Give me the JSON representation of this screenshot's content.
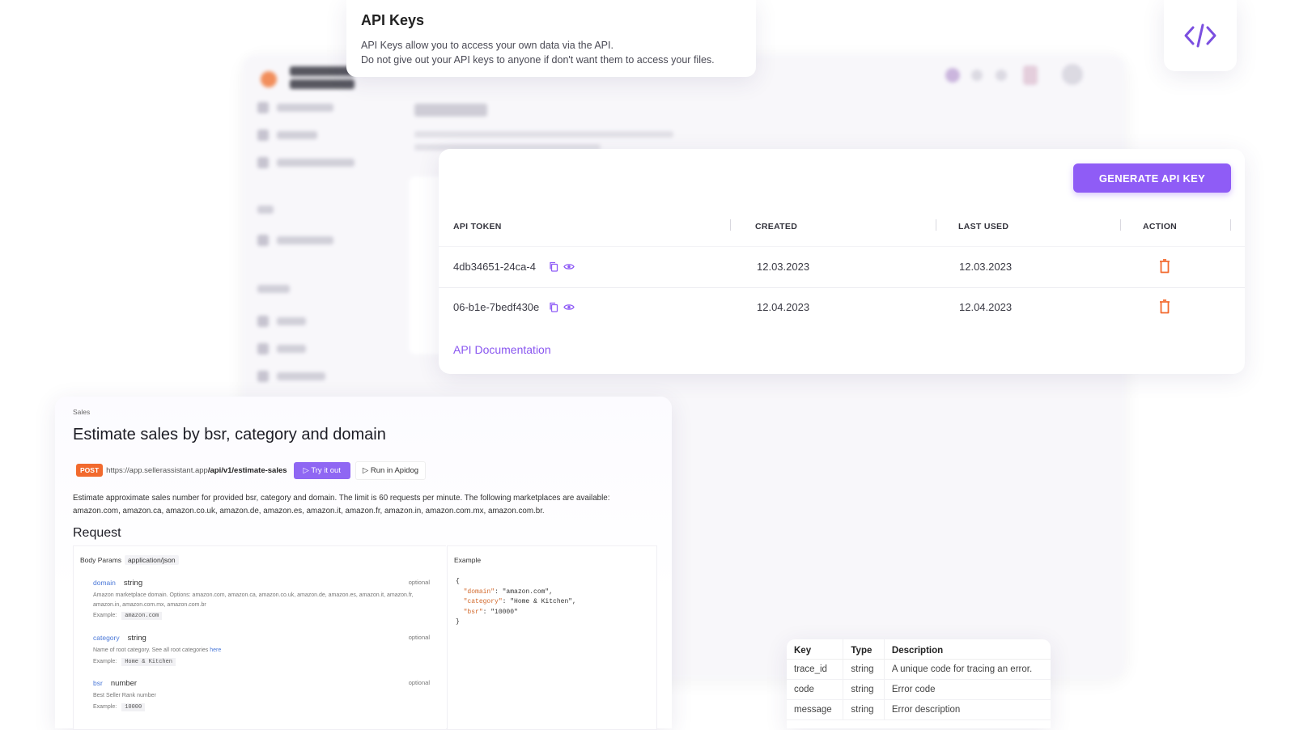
{
  "info_card": {
    "title": "API Keys",
    "line1": "API Keys allow you to access your own data via the API.",
    "line2": "Do not give out your API keys to anyone if don't want them to access your files."
  },
  "code_badge": {
    "icon": "code-brackets-icon",
    "color": "#7b4fe0"
  },
  "keys_card": {
    "generate_label": "GENERATE API KEY",
    "columns": [
      "API TOKEN",
      "CREATED",
      "LAST USED",
      "ACTION"
    ],
    "rows": [
      {
        "token": "4db34651-24ca-4",
        "created": "12.03.2023",
        "last_used": "12.03.2023"
      },
      {
        "token": "06-b1e-7bedf430e",
        "created": "12.04.2023",
        "last_used": "12.04.2023"
      }
    ],
    "doc_link": "API Documentation",
    "accent": "#8f5cf6",
    "delete_color": "#f26a2e"
  },
  "docs": {
    "crumb": "Sales",
    "title": "Estimate sales by bsr, category and domain",
    "method": "POST",
    "url_base": "https://app.sellerassistant.app",
    "url_path": "/api/v1/estimate-sales",
    "try_label": "▷ Try it out",
    "apidog_label": "▷ Run in Apidog",
    "description": "Estimate approximate sales number for provided bsr, category and domain. The limit is 60 requests per minute. The following marketplaces are available: amazon.com, amazon.ca, amazon.co.uk, amazon.de, amazon.es, amazon.it, amazon.fr, amazon.in, amazon.com.mx, amazon.com.br.",
    "request_heading": "Request",
    "body_params_label": "Body Params",
    "content_type": "application/json",
    "example_label": "Example",
    "params": [
      {
        "name": "domain",
        "type": "string",
        "optional": "optional",
        "desc": "Amazon marketplace domain. Options: amazon.com, amazon.ca, amazon.co.uk, amazon.de, amazon.es, amazon.it, amazon.fr, amazon.in, amazon.com.mx, amazon.com.br",
        "example_label": "Example:",
        "example": "amazon.com"
      },
      {
        "name": "category",
        "type": "string",
        "optional": "optional",
        "desc": "Name of root category. See all root categories",
        "desc_link": "here",
        "example_label": "Example:",
        "example": "Home & Kitchen"
      },
      {
        "name": "bsr",
        "type": "number",
        "optional": "optional",
        "desc": "Best Seller Rank number",
        "example_label": "Example:",
        "example": "10000"
      }
    ],
    "json_example": {
      "open": "{",
      "k1": "\"domain\"",
      "v1": ": \"amazon.com\",",
      "k2": "\"category\"",
      "v2": ": \"Home & Kitchen\",",
      "k3": "\"bsr\"",
      "v3": ": \"10000\"",
      "close": "}"
    }
  },
  "error_table": {
    "headers": [
      "Key",
      "Type",
      "Description"
    ],
    "rows": [
      [
        "trace_id",
        "string",
        "A unique code for tracing an error."
      ],
      [
        "code",
        "string",
        "Error code"
      ],
      [
        "message",
        "string",
        "Error description"
      ]
    ]
  }
}
